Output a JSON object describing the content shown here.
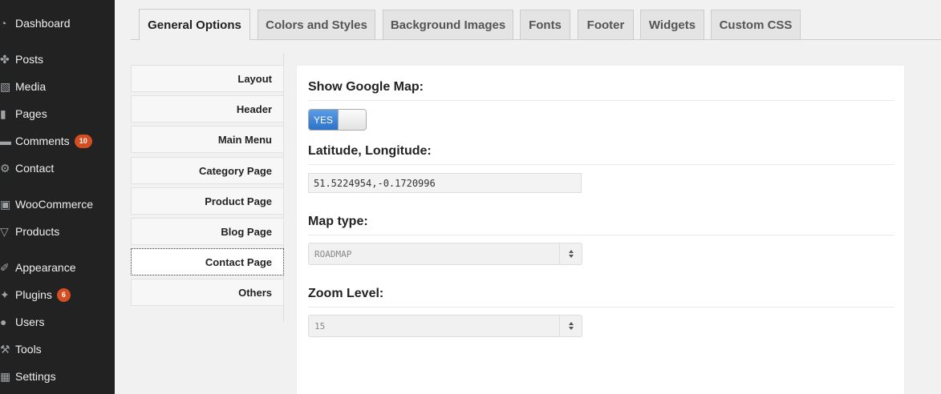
{
  "admin_menu": {
    "items": [
      {
        "label": "Dashboard",
        "icon": "dashboard-icon",
        "glyph": "◔"
      },
      {
        "label": "Posts",
        "icon": "pin-icon",
        "glyph": "✤"
      },
      {
        "label": "Media",
        "icon": "media-icon",
        "glyph": "▧"
      },
      {
        "label": "Pages",
        "icon": "pages-icon",
        "glyph": "▮"
      },
      {
        "label": "Comments",
        "icon": "comments-icon",
        "glyph": "▬",
        "badge": "10"
      },
      {
        "label": "Contact",
        "icon": "gear-icon",
        "glyph": "⚙"
      },
      {
        "label": "WooCommerce",
        "icon": "woocommerce-icon",
        "glyph": "▣"
      },
      {
        "label": "Products",
        "icon": "cart-icon",
        "glyph": "▽"
      },
      {
        "label": "Appearance",
        "icon": "brush-icon",
        "glyph": "✐"
      },
      {
        "label": "Plugins",
        "icon": "plugin-icon",
        "glyph": "✦",
        "badge": "6"
      },
      {
        "label": "Users",
        "icon": "users-icon",
        "glyph": "●"
      },
      {
        "label": "Tools",
        "icon": "wrench-icon",
        "glyph": "⚒"
      },
      {
        "label": "Settings",
        "icon": "settings-icon",
        "glyph": "▦"
      }
    ]
  },
  "tabs": [
    {
      "label": "General Options",
      "active": true
    },
    {
      "label": "Colors and Styles"
    },
    {
      "label": "Background Images"
    },
    {
      "label": "Fonts"
    },
    {
      "label": "Footer"
    },
    {
      "label": "Widgets"
    },
    {
      "label": "Custom CSS"
    }
  ],
  "subnav": {
    "items": [
      {
        "label": "Layout"
      },
      {
        "label": "Header"
      },
      {
        "label": "Main Menu"
      },
      {
        "label": "Category Page"
      },
      {
        "label": "Product Page"
      },
      {
        "label": "Blog Page"
      },
      {
        "label": "Contact Page",
        "active": true
      },
      {
        "label": "Others"
      }
    ]
  },
  "form": {
    "show_map": {
      "label": "Show Google Map:",
      "toggle_text": "YES"
    },
    "latlng": {
      "label": "Latitude, Longitude:",
      "value": "51.5224954,-0.1720996"
    },
    "map_type": {
      "label": "Map type:",
      "value": "ROADMAP"
    },
    "zoom": {
      "label": "Zoom Level:",
      "value": "15"
    }
  },
  "colors": {
    "sidebar_bg": "#222222",
    "badge": "#d54e21",
    "toggle_on": "#2b73c8"
  }
}
